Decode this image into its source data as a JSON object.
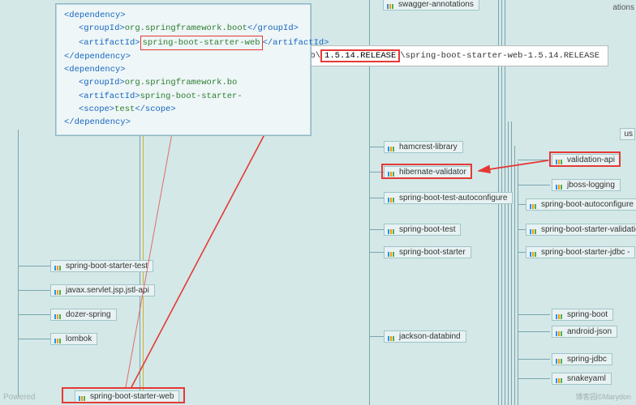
{
  "xml": {
    "dep_open": "<dependency>",
    "dep_close": "</dependency>",
    "groupId_open": "<groupId>",
    "groupId_close": "</groupId>",
    "artifactId_open": "<artifactId>",
    "artifactId_close": "</artifactId>",
    "scope_open": "<scope>",
    "scope_close": "</scope>",
    "groupId_val": "org.springframework.boot",
    "artifact1": "spring-boot-starter-web",
    "groupId2_partial": "org.springframework.bo",
    "artifact2_partial": "spring-boot-starter-",
    "scope_val": "test"
  },
  "path": {
    "prefix": "ng-boot-starter-web\\",
    "version": "1.5.14.RELEASE",
    "suffix": "\\spring-boot-starter-web-1.5.14.RELEASE"
  },
  "nodes": {
    "swagger_annotations": "swagger-annotations",
    "ations": "ations",
    "us": "us",
    "hamcrest_library": "hamcrest-library",
    "validation_api": "validation-api",
    "hibernate_validator": "hibernate-validator",
    "jboss_logging": "jboss-logging",
    "sb_test_autoconfigure": "spring-boot-test-autoconfigure",
    "sb_autoconfigure": "spring-boot-autoconfigure",
    "sb_test": "spring-boot-test",
    "sb_starter_validatio": "spring-boot-starter-validatio",
    "sb_starter": "spring-boot-starter",
    "sb_starter_jdbc": "spring-boot-starter-jdbc -",
    "sb_starter_test": "spring-boot-starter-test",
    "jstl_api": "javax.servlet.jsp.jstl-api",
    "dozer_spring": "dozer-spring",
    "spring_boot": "spring-boot",
    "android_json": "android-json",
    "lombok": "lombok",
    "jackson_databind": "jackson-databind",
    "spring_jdbc": "spring-jdbc",
    "snakeyaml": "snakeyaml",
    "sb_starter_web": "spring-boot-starter-web"
  },
  "watermark": "Powered",
  "credit": "博客园©Marydon"
}
